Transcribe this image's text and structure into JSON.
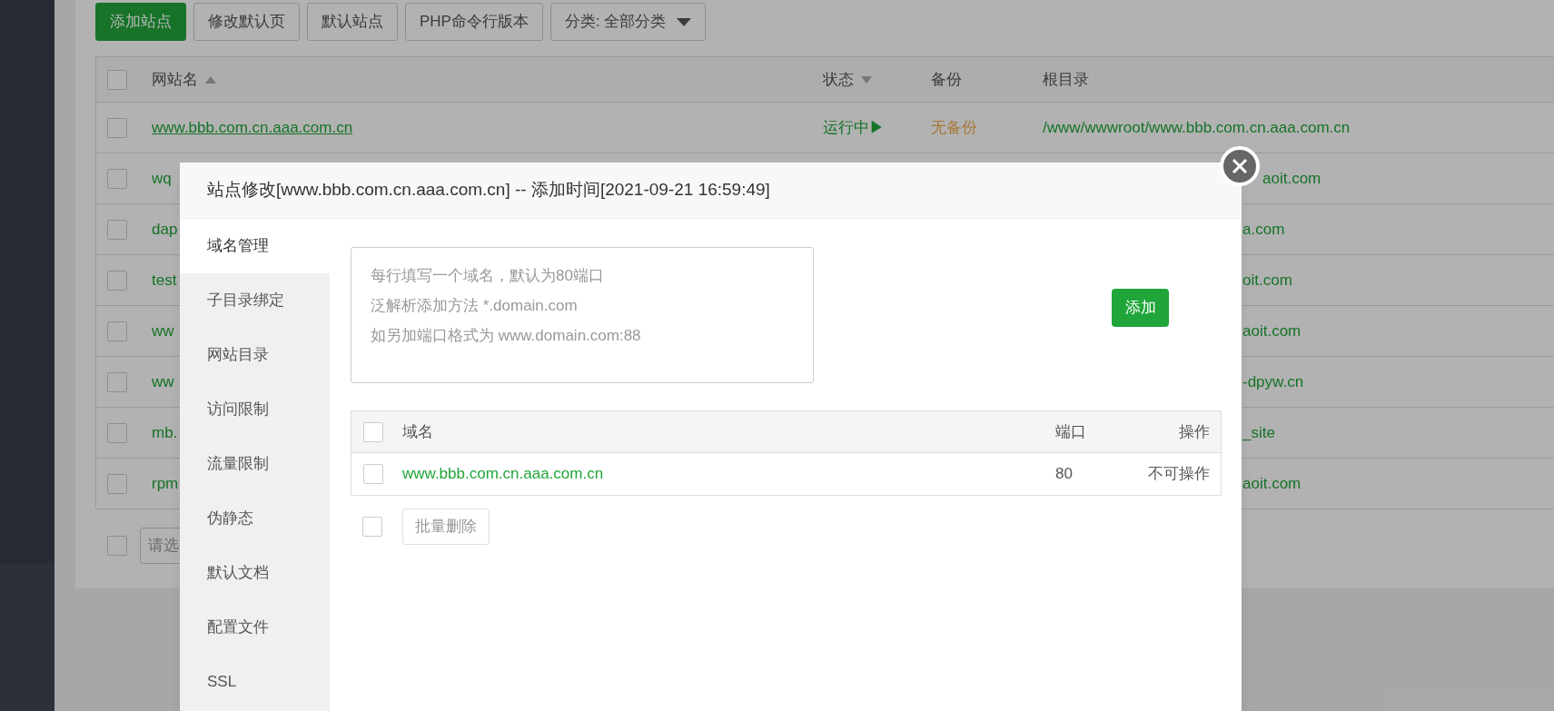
{
  "toolbar": {
    "buttons": [
      {
        "label": "添加站点",
        "kind": "primary"
      },
      {
        "label": "修改默认页",
        "kind": "default"
      },
      {
        "label": "默认站点",
        "kind": "default"
      },
      {
        "label": "PHP命令行版本",
        "kind": "default"
      },
      {
        "label": "分类: 全部分类",
        "kind": "dropdown"
      }
    ]
  },
  "site_table": {
    "all_checked": false,
    "columns": [
      {
        "label": "网站名",
        "sortable": true,
        "sort_up": true
      },
      {
        "label": "状态",
        "sortable": true,
        "sort_up": false
      },
      {
        "label": "备份",
        "sortable": false
      },
      {
        "label": "根目录",
        "sortable": false
      }
    ],
    "rows": [
      {
        "name": "www.bbb.com.cn.aaa.com.cn",
        "status": "运行中▶",
        "backup": "无备份",
        "root": "/www/wwwroot/www.bbb.com.cn.aaa.com.cn",
        "checked": false,
        "underlined": true
      },
      {
        "name": "wq",
        "root": "aoit.com",
        "checked": false,
        "underlined": false
      },
      {
        "name": "dap",
        "root": "a.com",
        "checked": false,
        "underlined": false
      },
      {
        "name": "test",
        "root": "oit.com",
        "checked": false,
        "underlined": false
      },
      {
        "name": "ww",
        "root": "aoit.com",
        "checked": false,
        "underlined": false
      },
      {
        "name": "ww",
        "root": "-dpyw.cn",
        "checked": false,
        "underlined": false
      },
      {
        "name": "mb.",
        "root": "_site",
        "checked": false,
        "underlined": false
      },
      {
        "name": "rpm",
        "root": "aoit.com",
        "checked": false,
        "underlined": false
      }
    ]
  },
  "batch": {
    "checked": false,
    "select": "请选"
  },
  "dialog": {
    "title": "站点修改[www.bbb.com.cn.aaa.com.cn] -- 添加时间[2021-09-21 16:59:49]",
    "menu": [
      {
        "label": "域名管理",
        "selected": true
      },
      {
        "label": "子目录绑定",
        "selected": false
      },
      {
        "label": "网站目录",
        "selected": false
      },
      {
        "label": "访问限制",
        "selected": false
      },
      {
        "label": "流量限制",
        "selected": false
      },
      {
        "label": "伪静态",
        "selected": false
      },
      {
        "label": "默认文档",
        "selected": false
      },
      {
        "label": "配置文件",
        "selected": false
      },
      {
        "label": "SSL",
        "selected": false
      }
    ],
    "domain_input": {
      "placeholder_lines": [
        "每行填写一个域名，默认为80端口",
        "泛解析添加方法 *.domain.com",
        "如另加端口格式为 www.domain.com:88"
      ]
    },
    "add_button": "添加",
    "domain_table": {
      "all_checked": false,
      "columns": [
        "域名",
        "端口",
        "操作"
      ],
      "rows": [
        {
          "domain": "www.bbb.com.cn.aaa.com.cn",
          "port": "80",
          "action": "不可操作",
          "checked": false
        }
      ]
    },
    "batch_checked": false,
    "batch_button": "批量删除"
  }
}
